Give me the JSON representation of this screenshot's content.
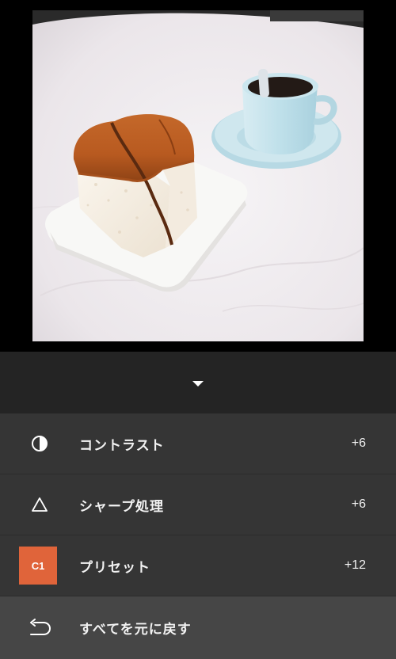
{
  "photo": {
    "subject_icon": "photo-image"
  },
  "panel": {
    "collapse_icon": "chevron-down-icon"
  },
  "adjustments": [
    {
      "icon": "contrast-icon",
      "label": "コントラスト",
      "value": "+6"
    },
    {
      "icon": "triangle-icon",
      "label": "シャープ処理",
      "value": "+6"
    },
    {
      "icon": "preset-badge",
      "badge_text": "C1",
      "label": "プリセット",
      "value": "+12"
    }
  ],
  "reset": {
    "icon": "undo-icon",
    "label": "すべてを元に戻す"
  },
  "colors": {
    "accent": "#e0643a",
    "panel_dark": "#242424",
    "row_bg": "#353535",
    "reset_bg": "#464646"
  }
}
